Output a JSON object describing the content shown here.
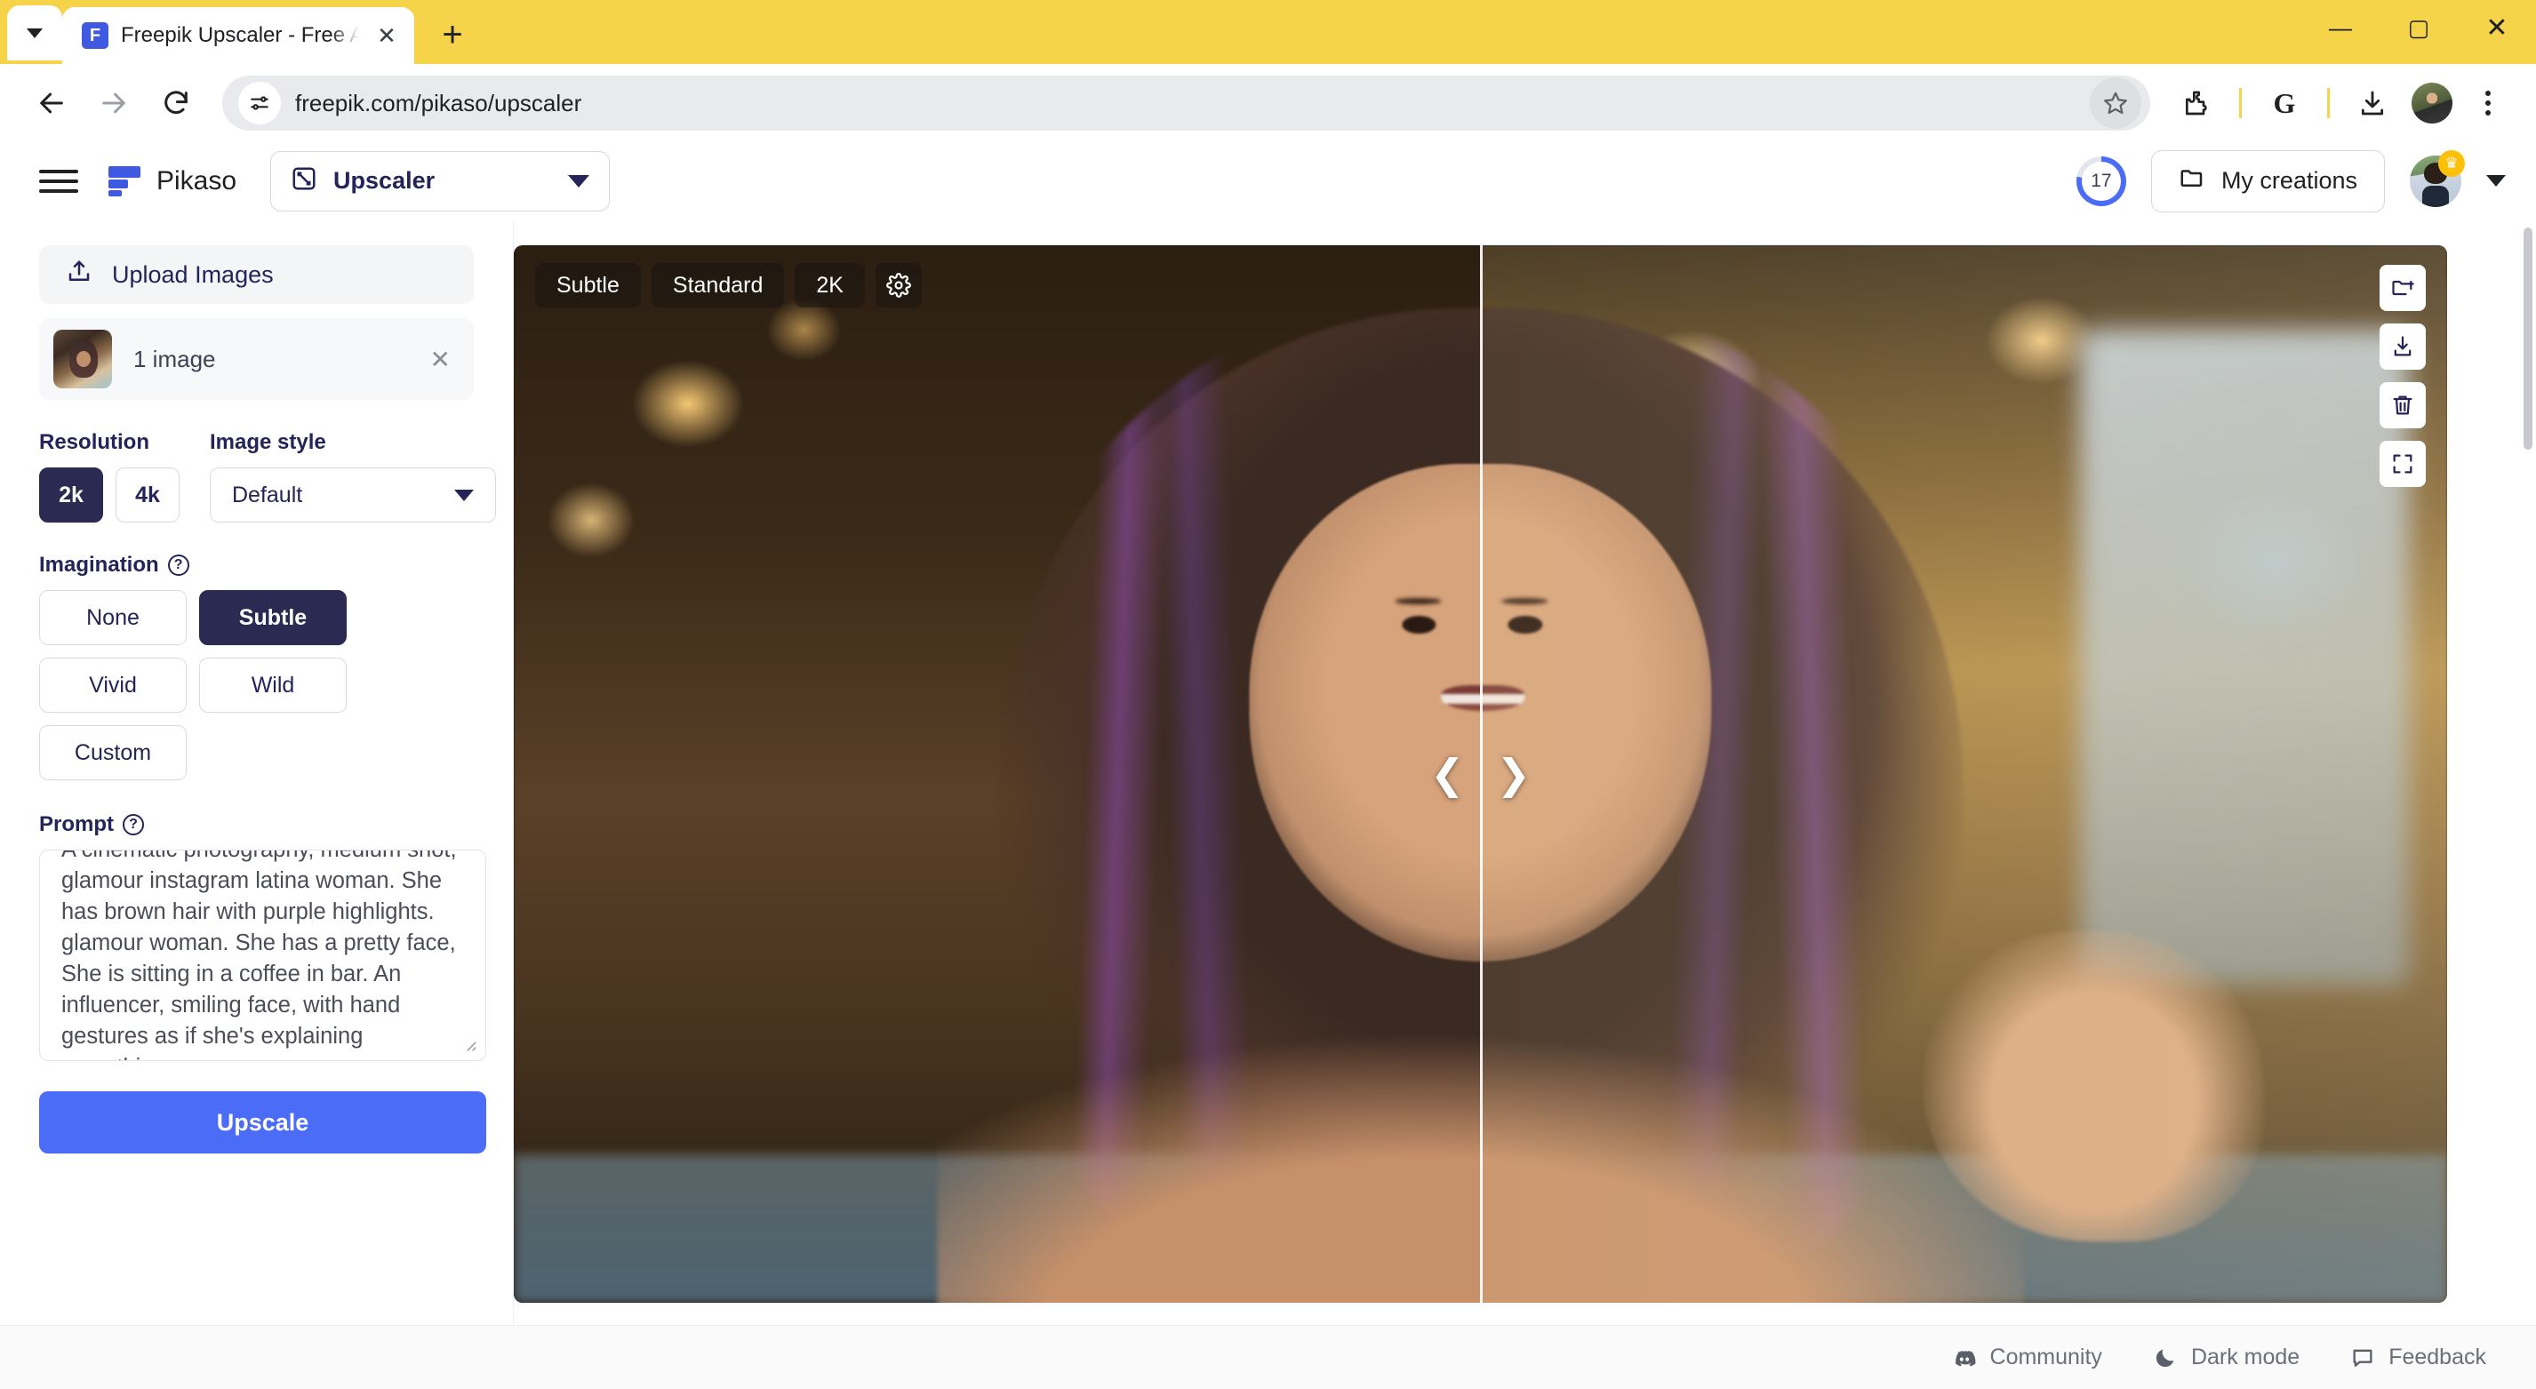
{
  "browser": {
    "tab": {
      "title": "Freepik Upscaler - Free AI imag",
      "favicon": "freepik-logo-icon",
      "close": "✕"
    },
    "newtab_label": "+",
    "window_controls": {
      "minimize": "—",
      "maximize": "▢",
      "close": "✕"
    },
    "nav": {
      "back": "←",
      "forward": "→",
      "reload": "⟳"
    },
    "omnibox": {
      "url": "freepik.com/pikaso/upscaler",
      "site_info_icon": "tune-icon",
      "bookmark_icon": "star-icon"
    },
    "toolbar_right": {
      "extensions_icon": "puzzle-icon",
      "google_icon": "G",
      "downloads_icon": "download-icon",
      "profile_icon": "profile-avatar",
      "menu_icon": "three-dots-icon"
    }
  },
  "header": {
    "menu_icon": "hamburger-icon",
    "brand": "Pikaso",
    "tool_selector": {
      "label": "Upscaler",
      "icon": "expand-icon",
      "chevron": "▼"
    },
    "credits": "17",
    "my_creations": {
      "label": "My creations",
      "icon": "folder-icon"
    },
    "account": {
      "badge_icon": "crown-icon",
      "chevron": "▼"
    }
  },
  "sidebar": {
    "upload": {
      "label": "Upload Images",
      "icon": "upload-icon"
    },
    "uploaded_image": {
      "caption": "1 image",
      "remove": "✕"
    },
    "resolution": {
      "label": "Resolution",
      "options": [
        "2k",
        "4k"
      ],
      "selected": "2k"
    },
    "image_style": {
      "label": "Image style",
      "selected": "Default",
      "chevron": "▼"
    },
    "imagination": {
      "label": "Imagination",
      "help": "?",
      "options": [
        "None",
        "Subtle",
        "Vivid",
        "Wild",
        "Custom"
      ],
      "selected": "Subtle"
    },
    "prompt": {
      "label": "Prompt",
      "help": "?",
      "value": "A cinematic photography, medium shot, glamour instagram latina woman. She has brown hair with purple highlights. glamour woman. She has a pretty face, She is sitting in a coffee in bar. An influencer, smiling face, with hand gestures as if she's explaining something"
    },
    "submit": {
      "label": "Upscale"
    }
  },
  "viewer": {
    "top_chips": [
      {
        "label": "Subtle",
        "name": "imagination-chip"
      },
      {
        "label": "Standard",
        "name": "mode-chip"
      },
      {
        "label": "2K",
        "name": "resolution-chip"
      }
    ],
    "settings_icon": "gear-icon",
    "side_tools": [
      {
        "icon": "folder-add-icon",
        "name": "add-to-folder-button"
      },
      {
        "icon": "download-icon",
        "name": "download-button"
      },
      {
        "icon": "trash-icon",
        "name": "delete-button"
      },
      {
        "icon": "fullscreen-icon",
        "name": "fullscreen-button"
      }
    ],
    "compare": {
      "prev": "❮",
      "next": "❯"
    }
  },
  "footer": {
    "items": [
      {
        "label": "Community",
        "icon": "discord-icon"
      },
      {
        "label": "Dark mode",
        "icon": "moon-icon"
      },
      {
        "label": "Feedback",
        "icon": "chat-icon"
      }
    ]
  },
  "colors": {
    "brand_blue": "#3f5ae0",
    "accent_blue": "#4a6cf7",
    "dark_navy": "#2a2a52",
    "browser_theme": "#f5d44a",
    "crown_yellow": "#ffc107"
  }
}
